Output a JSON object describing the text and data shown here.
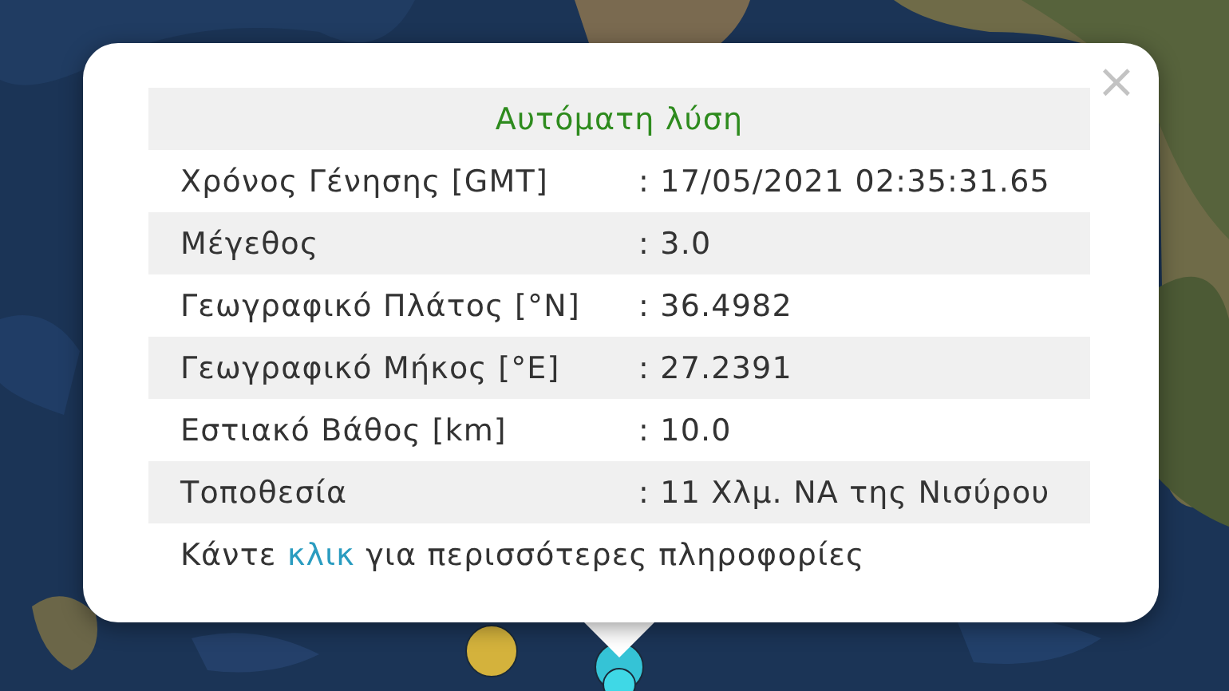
{
  "popup": {
    "title": "Αυτόματη λύση",
    "close": "×",
    "rows": [
      {
        "label": "Χρόνος Γένησης [GMT]",
        "value": ": 17/05/2021 02:35:31.65"
      },
      {
        "label": "Μέγεθος",
        "value": ": 3.0"
      },
      {
        "label": "Γεωγραφικό Πλάτος [°N]",
        "value": ": 36.4982"
      },
      {
        "label": "Γεωγραφικό Μήκος [°E]",
        "value": ": 27.2391"
      },
      {
        "label": "Εστιακό Βάθος [km]",
        "value": ": 10.0"
      },
      {
        "label": "Τοποθεσία",
        "value": ": 11 Χλμ. ΝΑ της Νισύρου"
      }
    ],
    "footer": {
      "before": "Κάντε ",
      "link": "κλικ",
      "after": " για περισσότερες πληροφορίες"
    }
  },
  "markers": [
    {
      "color": "#d4b23c"
    },
    {
      "color": "#35c3d6"
    },
    {
      "color": "#3fd8e6"
    }
  ]
}
